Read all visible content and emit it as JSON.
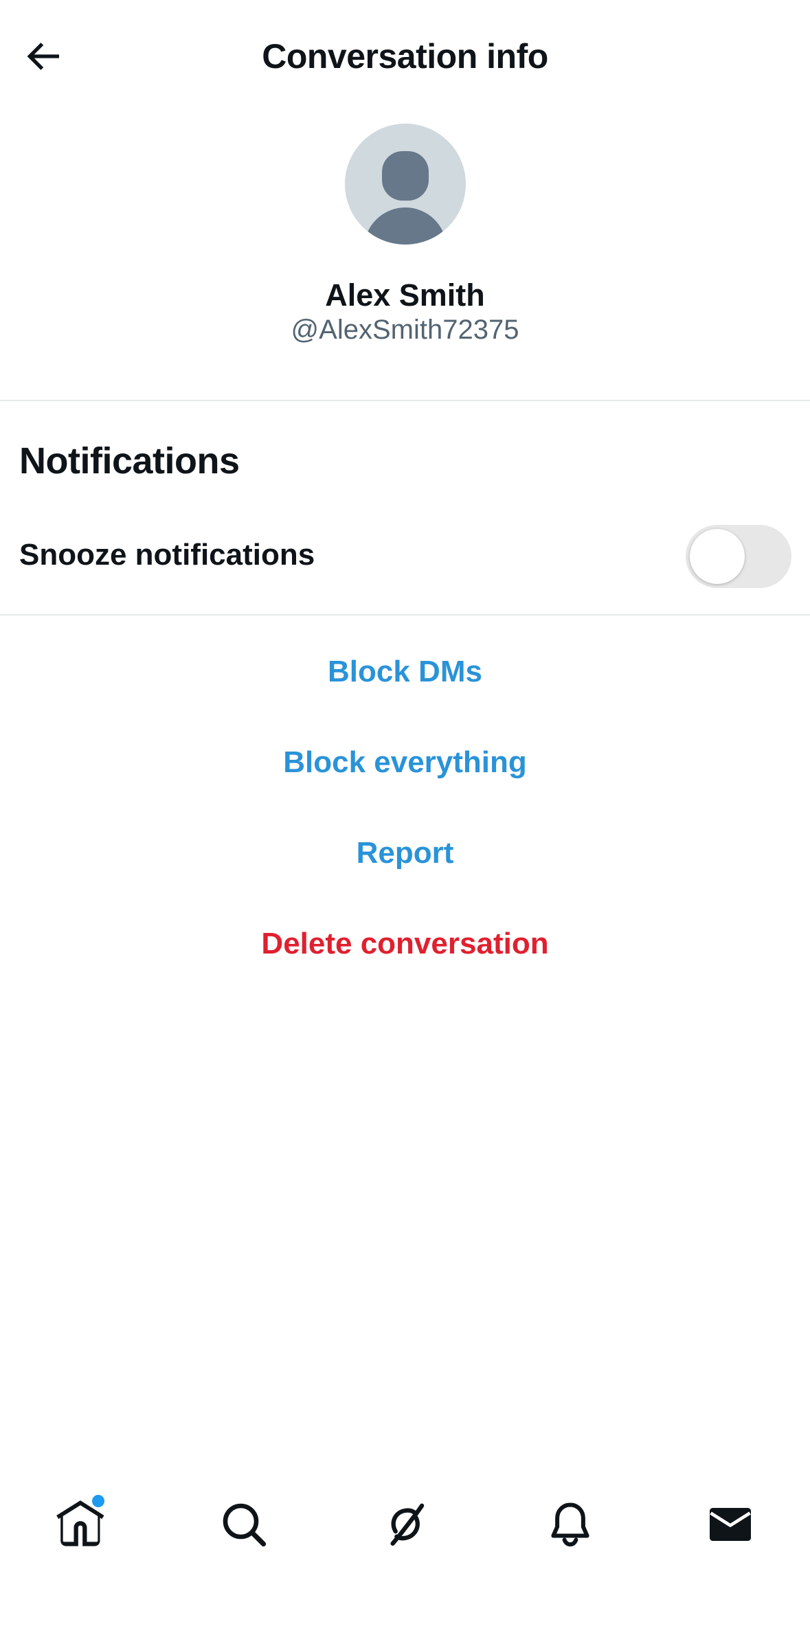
{
  "header": {
    "title": "Conversation info",
    "back_icon": "arrow-left-icon"
  },
  "profile": {
    "name": "Alex Smith",
    "handle": "@AlexSmith72375",
    "avatar_icon": "default-avatar-icon"
  },
  "notifications": {
    "section_title": "Notifications",
    "snooze_label": "Snooze notifications",
    "snooze_enabled": false
  },
  "actions": {
    "block_dms": "Block DMs",
    "block_everything": "Block everything",
    "report": "Report",
    "delete_conversation": "Delete conversation"
  },
  "bottom_nav": {
    "items": [
      {
        "icon": "home-icon",
        "has_notification_dot": true
      },
      {
        "icon": "search-icon",
        "has_notification_dot": false
      },
      {
        "icon": "grok-icon",
        "has_notification_dot": false
      },
      {
        "icon": "bell-icon",
        "has_notification_dot": false
      },
      {
        "icon": "mail-icon",
        "has_notification_dot": false,
        "active": true
      }
    ]
  },
  "colors": {
    "text_primary": "#0f1419",
    "text_secondary": "#536471",
    "accent_blue": "#1d9bf0",
    "link_blue": "#2a93d8",
    "danger_red": "#e0202f",
    "divider": "#e7e9ea",
    "avatar_bg": "#cfd9de",
    "avatar_fg": "#66788a"
  }
}
